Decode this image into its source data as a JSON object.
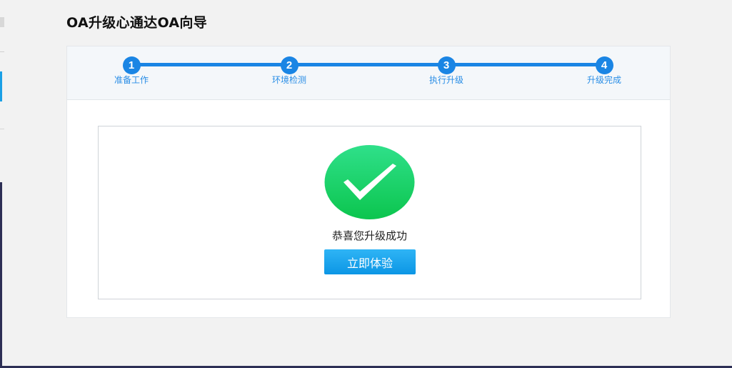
{
  "page_title": "OA升级心通达OA向导",
  "steps": [
    {
      "number": "1",
      "label": "准备工作"
    },
    {
      "number": "2",
      "label": "环境检测"
    },
    {
      "number": "3",
      "label": "执行升级"
    },
    {
      "number": "4",
      "label": "升级完成"
    }
  ],
  "result": {
    "icon": "check-circle-icon",
    "message": "恭喜您升级成功",
    "button_label": "立即体验"
  },
  "colors": {
    "step_accent": "#1a85e4",
    "success_green": "#14cf66",
    "button_blue": "#15a0ec"
  }
}
